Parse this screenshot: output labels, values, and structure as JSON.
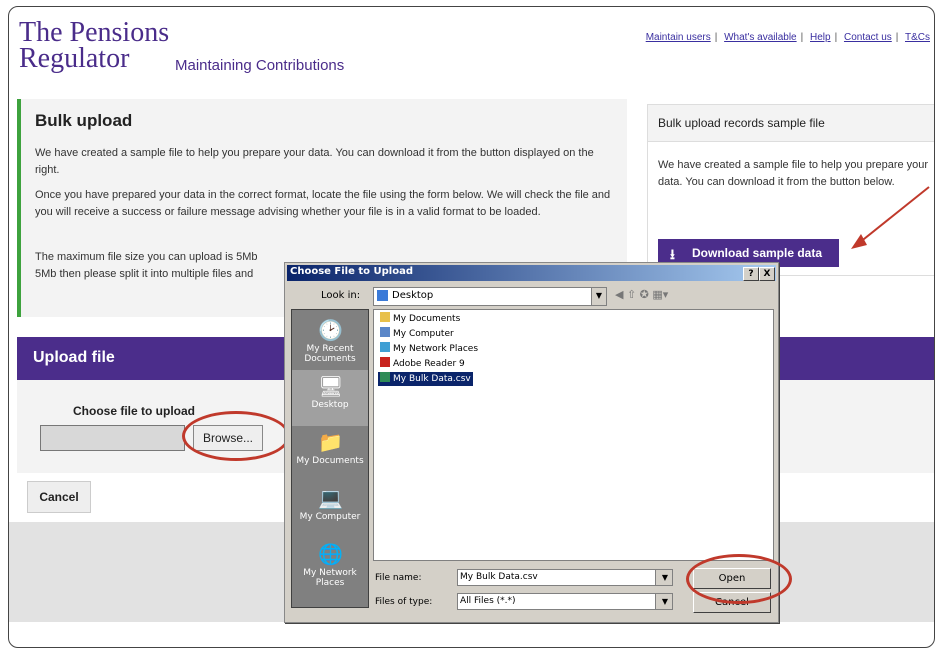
{
  "brand": {
    "logo_line1": "The Pensions",
    "logo_line2": "Regulator",
    "app_title": "Maintaining Contributions"
  },
  "top_links": [
    "Maintain users",
    "What's available",
    "Help",
    "Contact us",
    "T&Cs"
  ],
  "bulk": {
    "title": "Bulk upload",
    "p1": "We have created a sample file to help you prepare your data. You can download it from the button displayed on the right.",
    "p2": "Once you have prepared your data in the correct format, locate the file using the form below. We will check the file and you will receive a success or failure message advising whether your file is in a valid format to be loaded.",
    "p3": "The maximum file size you can upload is 5Mb",
    "p4": "5Mb then please split it into multiple files and"
  },
  "sample": {
    "title": "Bulk upload records sample file",
    "text": "We have created a sample file to help you prepare your data. You can download it from the button below.",
    "button": "Download sample data",
    "button_icon": "download-icon"
  },
  "upload": {
    "title": "Upload file",
    "choose_label": "Choose file to upload",
    "browse": "Browse...",
    "cancel": "Cancel"
  },
  "dialog": {
    "title": "Choose File to Upload",
    "help_btn": "?",
    "close_btn": "X",
    "look_in_label": "Look in:",
    "look_in_value": "Desktop",
    "places": [
      "My Recent Documents",
      "Desktop",
      "My Documents",
      "My Computer",
      "My Network Places"
    ],
    "files": [
      "My Documents",
      "My Computer",
      "My Network Places",
      "Adobe Reader 9",
      "My Bulk Data.csv"
    ],
    "file_name_label": "File name:",
    "file_name_value": "My Bulk Data.csv",
    "file_type_label": "Files of type:",
    "file_type_value": "All Files (*.*)",
    "open": "Open",
    "cancel": "Cancel"
  },
  "colors": {
    "brand": "#4b2d8b",
    "accent_green": "#3da23d",
    "highlight": "#c0392b"
  }
}
